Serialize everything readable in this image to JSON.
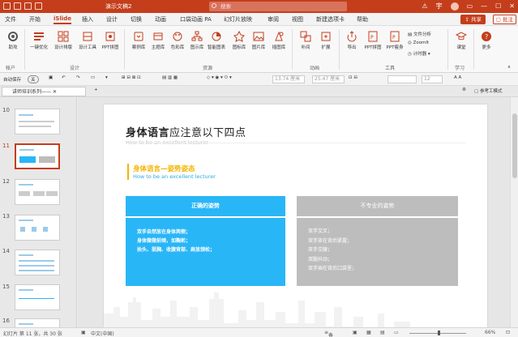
{
  "window": {
    "title": "演示文稿2",
    "search_placeholder": "搜索",
    "user_initial": "宇"
  },
  "tabs": [
    "文件",
    "开始",
    "iSlide",
    "插入",
    "设计",
    "切换",
    "动画",
    "口袋动画 PA",
    "幻灯片放映",
    "审阅",
    "视图",
    "新建选项卡",
    "帮助"
  ],
  "share_label": "共享",
  "comment_label": "批注",
  "ribbon": {
    "account": "助攻",
    "account_group": "帐户",
    "design_buttons": [
      "一键优化",
      "设计排版",
      "设计工具",
      "PPT拼图"
    ],
    "design_group": "设计",
    "resource_buttons": [
      "案例库",
      "主题库",
      "色彩库",
      "图示库",
      "智能图表",
      "图标库",
      "图片库",
      "插图库"
    ],
    "resource_group": "资源",
    "anim_buttons": [
      "补间",
      "扩展"
    ],
    "anim_group": "动画",
    "tool_buttons": [
      "导出",
      "PPT拼图",
      "PPT瘦身"
    ],
    "tool_small": [
      "文件分析",
      "ZoomIt",
      "计时器"
    ],
    "tool_group": "工具",
    "learn_button": "课堂",
    "learn_group": "学习",
    "more_button": "更多"
  },
  "formatbar": {
    "autosave": "自动保存",
    "toggle": "关",
    "width": "13.74 厘米",
    "height": "25.47 厘米",
    "fontsize": "12"
  },
  "doc_tab": "讲师培训系列——",
  "ref_mode": "参考工模式",
  "thumbnails": [
    {
      "num": "10",
      "selected": false
    },
    {
      "num": "11",
      "selected": true
    },
    {
      "num": "12",
      "selected": false
    },
    {
      "num": "13",
      "selected": false
    },
    {
      "num": "14",
      "selected": false
    },
    {
      "num": "15",
      "selected": false
    },
    {
      "num": "16",
      "selected": false
    }
  ],
  "slide": {
    "title_bold": "身体语言",
    "title_rest": "应注意以下四点",
    "subtitle": "How to be an excellent lecturer",
    "section_title": "身体语言—姿势姿态",
    "section_sub": "How to be an excellent lecturer",
    "left_header": "正确的姿势",
    "right_header": "不专业的姿势",
    "left_lines": [
      "双手自然放在身体两侧；",
      "身体微微前倾，如鞠躬；",
      "抬头、挺胸、收腹背部、肩放颈松；"
    ],
    "right_lines": [
      "双手交叉；",
      "双手放在背后紧握；",
      "双手交腰；",
      "双腿抖动；",
      "双手插在背后口袋里；"
    ]
  },
  "status": {
    "slide_info": "幻灯片 第 11 张，共 30 张",
    "language": "中文(中国)",
    "notes": "备注",
    "zoom": "66%"
  }
}
